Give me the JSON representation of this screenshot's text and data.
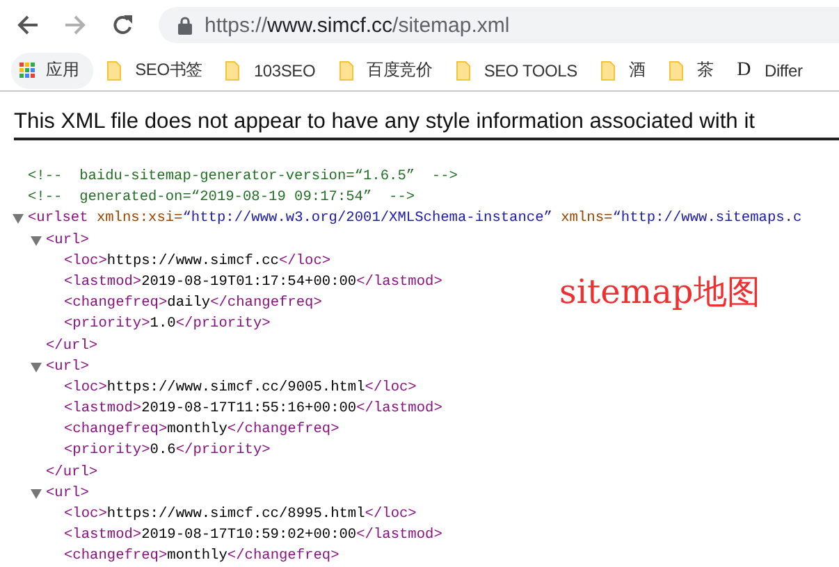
{
  "toolbar": {
    "nav_buttons": [
      {
        "kind": "back",
        "disabled": false
      },
      {
        "kind": "forward",
        "disabled": true
      },
      {
        "kind": "reload",
        "disabled": false
      }
    ],
    "address": {
      "secure": true,
      "scheme": "https://",
      "host": "www.simcf.cc",
      "path": "/sitemap.xml"
    }
  },
  "bookmarks": [
    {
      "kind": "apps",
      "label": "应用"
    },
    {
      "kind": "folder",
      "label": "SEO书签"
    },
    {
      "kind": "folder",
      "label": "103SEO"
    },
    {
      "kind": "folder",
      "label": "百度竞价"
    },
    {
      "kind": "folder",
      "label": "SEO TOOLS"
    },
    {
      "kind": "folder",
      "label": "酒"
    },
    {
      "kind": "folder",
      "label": "茶"
    },
    {
      "kind": "site",
      "icon_letter": "D",
      "label": "Differ"
    }
  ],
  "notice": "This XML file does not appear to have any style information associated with it",
  "xml": {
    "comments": [
      "<!--  baidu-sitemap-generator-version=“1.6.5”  -->",
      "<!--  generated-on=“2019-08-19 09:17:54”  -->"
    ],
    "root": {
      "expanded": true,
      "parts": [
        {
          "kind": "tag",
          "text": "<urlset"
        },
        {
          "kind": "attr",
          "text": " xmlns:xsi="
        },
        {
          "kind": "value",
          "text": "“http://www.w3.org/2001/XMLSchema-instance”"
        },
        {
          "kind": "attr",
          "text": " xmlns="
        },
        {
          "kind": "value",
          "text": "“http://www.sitemaps.c"
        }
      ],
      "children": [
        {
          "expanded": true,
          "parts": [
            {
              "kind": "tag",
              "text": "<url>"
            }
          ],
          "children": [
            {
              "open": "<loc>",
              "text": "https://www.simcf.cc",
              "close": "</loc>"
            },
            {
              "open": "<lastmod>",
              "text": "2019-08-19T01:17:54+00:00",
              "close": "</lastmod>"
            },
            {
              "open": "<changefreq>",
              "text": "daily",
              "close": "</changefreq>"
            },
            {
              "open": "<priority>",
              "text": "1.0",
              "close": "</priority>"
            }
          ],
          "close": "</url>"
        },
        {
          "expanded": true,
          "parts": [
            {
              "kind": "tag",
              "text": "<url>"
            }
          ],
          "children": [
            {
              "open": "<loc>",
              "text": "https://www.simcf.cc/9005.html",
              "close": "</loc>"
            },
            {
              "open": "<lastmod>",
              "text": "2019-08-17T11:55:16+00:00",
              "close": "</lastmod>"
            },
            {
              "open": "<changefreq>",
              "text": "monthly",
              "close": "</changefreq>"
            },
            {
              "open": "<priority>",
              "text": "0.6",
              "close": "</priority>"
            }
          ],
          "close": "</url>"
        },
        {
          "expanded": true,
          "parts": [
            {
              "kind": "tag",
              "text": "<url>"
            }
          ],
          "children": [
            {
              "open": "<loc>",
              "text": "https://www.simcf.cc/8995.html",
              "close": "</loc>"
            },
            {
              "open": "<lastmod>",
              "text": "2019-08-17T10:59:02+00:00",
              "close": "</lastmod>"
            },
            {
              "open": "<changefreq>",
              "text": "monthly",
              "close": "</changefreq>"
            }
          ]
        }
      ]
    }
  },
  "annotation": "sitemap地图"
}
